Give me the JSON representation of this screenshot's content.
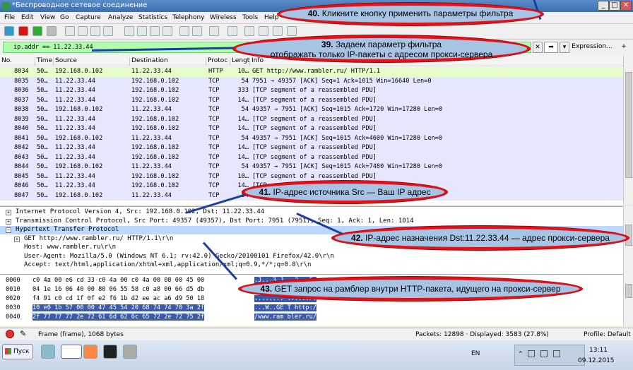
{
  "window": {
    "title": "*Беспроводное сетевое соединение"
  },
  "menu": [
    "File",
    "Edit",
    "View",
    "Go",
    "Capture",
    "Analyze",
    "Statistics",
    "Telephony",
    "Wireless",
    "Tools",
    "Help"
  ],
  "filter": {
    "value": "ip.addr == 11.22.33.44",
    "expression_label": "Expression...",
    "plus_label": "+"
  },
  "columns": [
    "No.",
    "Time",
    "Source",
    "Destination",
    "Protoc",
    "Lengt",
    "Info"
  ],
  "packets": [
    {
      "no": "8034",
      "time": "50…",
      "src": "192.168.0.102",
      "dst": "11.22.33.44",
      "proto": "HTTP",
      "len": "10…",
      "info": "GET http://www.rambler.ru/ HTTP/1.1",
      "kind": "sel"
    },
    {
      "no": "8035",
      "time": "50…",
      "src": "11.22.33.44",
      "dst": "192.168.0.102",
      "proto": "TCP",
      "len": "54",
      "info": "7951 → 49357 [ACK] Seq=1 Ack=1015 Win=16640 Len=0",
      "kind": "tcp"
    },
    {
      "no": "8036",
      "time": "50…",
      "src": "11.22.33.44",
      "dst": "192.168.0.102",
      "proto": "TCP",
      "len": "333",
      "info": "[TCP segment of a reassembled PDU]",
      "kind": "tcp"
    },
    {
      "no": "8037",
      "time": "50…",
      "src": "11.22.33.44",
      "dst": "192.168.0.102",
      "proto": "TCP",
      "len": "14…",
      "info": "[TCP segment of a reassembled PDU]",
      "kind": "tcp"
    },
    {
      "no": "8038",
      "time": "50…",
      "src": "192.168.0.102",
      "dst": "11.22.33.44",
      "proto": "TCP",
      "len": "54",
      "info": "49357 → 7951 [ACK] Seq=1015 Ack=1720 Win=17280 Len=0",
      "kind": "tcp"
    },
    {
      "no": "8039",
      "time": "50…",
      "src": "11.22.33.44",
      "dst": "192.168.0.102",
      "proto": "TCP",
      "len": "14…",
      "info": "[TCP segment of a reassembled PDU]",
      "kind": "tcp"
    },
    {
      "no": "8040",
      "time": "50…",
      "src": "11.22.33.44",
      "dst": "192.168.0.102",
      "proto": "TCP",
      "len": "14…",
      "info": "[TCP segment of a reassembled PDU]",
      "kind": "tcp"
    },
    {
      "no": "8041",
      "time": "50…",
      "src": "192.168.0.102",
      "dst": "11.22.33.44",
      "proto": "TCP",
      "len": "54",
      "info": "49357 → 7951 [ACK] Seq=1015 Ack=4600 Win=17280 Len=0",
      "kind": "tcp"
    },
    {
      "no": "8042",
      "time": "50…",
      "src": "11.22.33.44",
      "dst": "192.168.0.102",
      "proto": "TCP",
      "len": "14…",
      "info": "[TCP segment of a reassembled PDU]",
      "kind": "tcp"
    },
    {
      "no": "8043",
      "time": "50…",
      "src": "11.22.33.44",
      "dst": "192.168.0.102",
      "proto": "TCP",
      "len": "14…",
      "info": "[TCP segment of a reassembled PDU]",
      "kind": "tcp"
    },
    {
      "no": "8044",
      "time": "50…",
      "src": "192.168.0.102",
      "dst": "11.22.33.44",
      "proto": "TCP",
      "len": "54",
      "info": "49357 → 7951 [ACK] Seq=1015 Ack=7480 Win=17280 Len=0",
      "kind": "tcp"
    },
    {
      "no": "8045",
      "time": "50…",
      "src": "11.22.33.44",
      "dst": "192.168.0.102",
      "proto": "TCP",
      "len": "10…",
      "info": "[TCP segment of a reassembled PDU]",
      "kind": "tcp"
    },
    {
      "no": "8046",
      "time": "50…",
      "src": "11.22.33.44",
      "dst": "192.168.0.102",
      "proto": "TCP",
      "len": "14…",
      "info": "[TCP segment of a reassembled PDU]",
      "kind": "tcp"
    },
    {
      "no": "8047",
      "time": "50…",
      "src": "192.168.0.102",
      "dst": "11.22.33.44",
      "proto": "TCP",
      "len": "54",
      "info": "49357 → 7951 [ACK] Seq=1015 Ack=",
      "kind": "tcp"
    }
  ],
  "details": [
    {
      "exp": "+",
      "text": "Internet Protocol Version 4, Src: 192.168.0.102, Dst: 11.22.33.44"
    },
    {
      "exp": "+",
      "text": "Transmission Control Protocol, Src Port: 49357 (49357), Dst Port: 7951 (7951), Seq: 1, Ack: 1, Len: 1014"
    },
    {
      "exp": "−",
      "text": "Hypertext Transfer Protocol"
    },
    {
      "exp": "+",
      "text": "GET http://www.rambler.ru/ HTTP/1.1\\r\\n"
    },
    {
      "exp": "",
      "text": "Host: www.rambler.ru\\r\\n"
    },
    {
      "exp": "",
      "text": "User-Agent: Mozilla/5.0 (Windows NT 6.1; rv:42.0) Gecko/20100101 Firefox/42.0\\r\\n"
    },
    {
      "exp": "",
      "text": "Accept: text/html,application/xhtml+xml,application/xml;q=0.9,*/*;q=0.8\\r\\n"
    }
  ],
  "hex": [
    {
      "off": "0000",
      "bytes": "c0 4a 00 e6 cd 33 c0 4a  00 c0 4a 00 08 00 45 00",
      "ascii": ".J...3.J ..J...E."
    },
    {
      "off": "0010",
      "bytes": "04 1e 16 06 40 00 80 06  55 58 c0 a8 00 66 d5 db",
      "ascii": "....@... UX...f.."
    },
    {
      "off": "0020",
      "bytes": "f4 91 c0 cd 1f 0f e2 f6  1b d2 ee ac a6 d9 50 18",
      "ascii": "........ ......P."
    },
    {
      "off": "0030",
      "bytes": "10 e0 1b 57 00 00 47 45  54 20 68 74 74 70 3a 2f",
      "ascii": "...W..GE T http:/"
    },
    {
      "off": "0040",
      "bytes": "2f 77 77 77 2e 72 61 6d  62 6c 65 72 2e 72 75 2f",
      "ascii": "/www.ram bler.ru/"
    }
  ],
  "status": {
    "frame": "Frame (frame), 1068 bytes",
    "packets": "Packets: 12898 · Displayed: 3583 (27.8%)",
    "profile": "Profile: Default"
  },
  "taskbar": {
    "start": "Пуск",
    "lang": "EN",
    "time": "13:11",
    "date": "09.12.2015"
  },
  "callouts": {
    "c40_num": "40.",
    "c40_text": "Кликните кнопку применить параметры фильтра",
    "c39_num": "39.",
    "c39_line1": "Задаем параметр фильтра",
    "c39_line2": "отображать только IP-пакеты с адресом прокси-сервера",
    "c41_num": "41.",
    "c41_text": "IP-адрес источника Src — Ваш IP адрес",
    "c42_num": "42.",
    "c42_text": "IP-адрес назначения Dst:11.22.33.44 — адрес прокси-сервера",
    "c43_num": "43.",
    "c43_text": "GET запрос на рамблер внутри HTTP-пакета, идущего на прокси-сервер"
  },
  "colors": {
    "filter_ok": "#afffaf",
    "tcp_row": "#e7e6ff",
    "http_row": "#e4ffc7",
    "callout_fill": "#a7c4e4",
    "callout_border": "#e0131b",
    "selection": "#3b5ba9"
  }
}
